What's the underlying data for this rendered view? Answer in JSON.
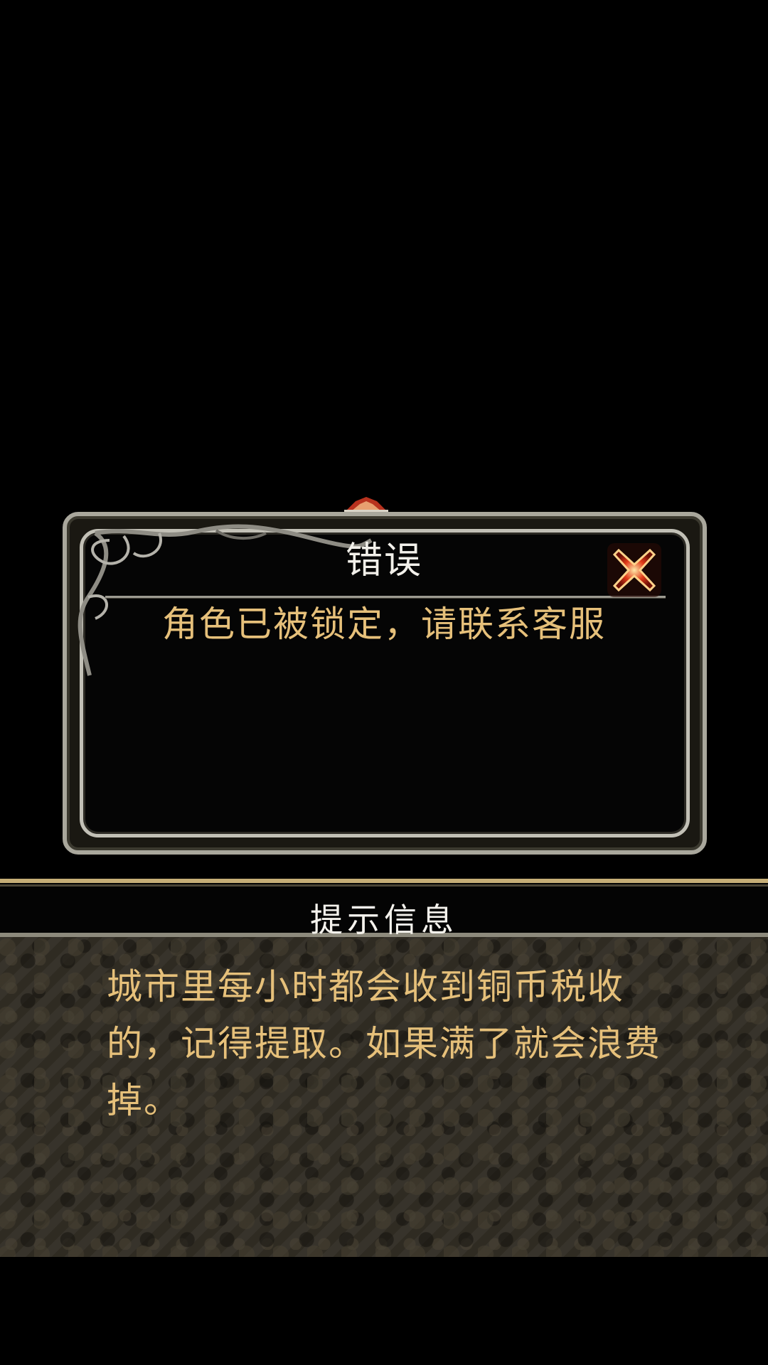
{
  "dialog": {
    "title": "错误",
    "message": "角色已被锁定，请联系客服",
    "close_icon": "close-x-icon"
  },
  "tip_panel": {
    "header": "提示信息",
    "text": "城市里每小时都会收到铜币税收的，记得提取。如果满了就会浪费掉。"
  },
  "colors": {
    "title_text": "#f2f0ea",
    "message_text": "#e6c07a",
    "frame": "#c2c0b6",
    "close_red": "#e02a1a"
  }
}
